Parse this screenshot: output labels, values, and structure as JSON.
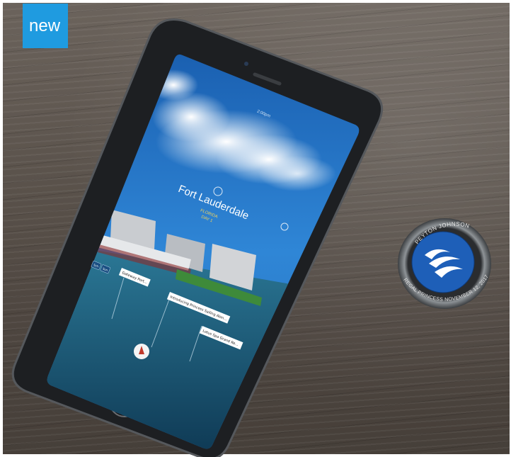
{
  "badge": {
    "label": "new"
  },
  "phone": {
    "app_screen": {
      "time": "2:00pm",
      "destination": "Fort Lauderdale",
      "region": "FLORIDA",
      "day": "DAY 1",
      "chips": [
        "Sch",
        "Sun"
      ],
      "timeline_cards": [
        "Gateway Port…",
        "Introducing Princess Sailing Alon…",
        "Lotus Spa Grand Re…"
      ]
    }
  },
  "medallion": {
    "name": "PEYTON JOHNSON",
    "ship_and_date": "REGAL PRINCESS NOVEMBER 12, 2017"
  },
  "colors": {
    "badge": "#1f9be0",
    "medallion_blue": "#1e5fb8",
    "sky": "#2a7fd4"
  }
}
